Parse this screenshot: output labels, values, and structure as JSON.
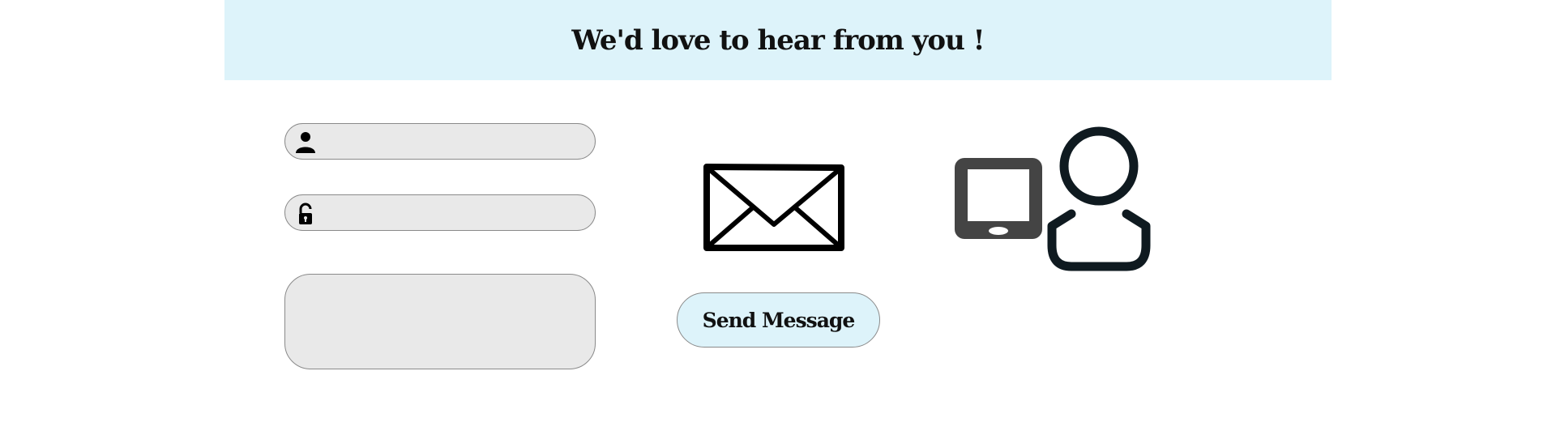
{
  "header": {
    "title": "We'd love to hear from you !",
    "background": "#ddf3fa"
  },
  "form": {
    "name_field": {
      "icon": "person-icon",
      "value": "",
      "placeholder": ""
    },
    "password_field": {
      "icon": "unlock-icon",
      "value": "",
      "placeholder": ""
    },
    "message_field": {
      "value": "",
      "placeholder": ""
    },
    "send_label": "Send Message"
  },
  "illustrations": {
    "envelope": "envelope-icon",
    "contact": "phone-person-icon"
  },
  "colors": {
    "banner": "#ddf3fa",
    "field_bg": "#e9e9e9",
    "button_bg": "#ddf3fa",
    "icon_dark": "#0f1a20",
    "phone_gray": "#444444"
  }
}
